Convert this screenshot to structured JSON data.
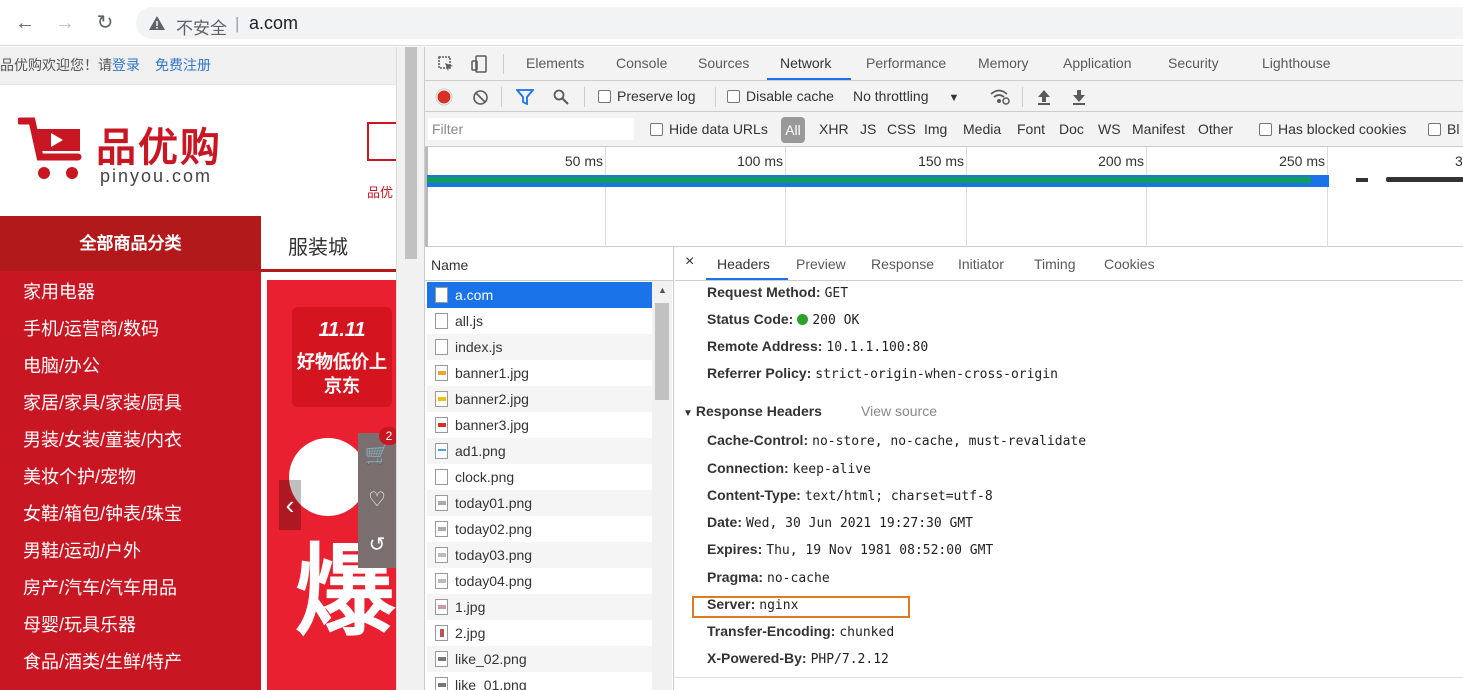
{
  "browser": {
    "insecure_label": "不安全",
    "separator": "|",
    "url": "a.com"
  },
  "site": {
    "welcome": "品优购欢迎您！请",
    "login": "登录",
    "register": "免费注册",
    "brand": "品优购",
    "domain": "pinyou.com",
    "search_hint": "品优",
    "all_categories": "全部商品分类",
    "nav_tab": "服装城",
    "categories": [
      "家用电器",
      "手机/运营商/数码",
      "电脑/办公",
      "家居/家具/家装/厨具",
      "男装/女装/童装/内衣",
      "美妆个护/宠物",
      "女鞋/箱包/钟表/珠宝",
      "男鞋/运动/户外",
      "房产/汽车/汽车用品",
      "母婴/玩具乐器",
      "食品/酒类/生鲜/特产"
    ],
    "banner_tag": "好物低价上京东",
    "banner_tag_top": "11.11",
    "banner_big": "爆",
    "cart_badge": "2"
  },
  "devtools": {
    "tabs": [
      "Elements",
      "Console",
      "Sources",
      "Network",
      "Performance",
      "Memory",
      "Application",
      "Security",
      "Lighthouse"
    ],
    "active_tab": "Network",
    "toolbar": {
      "preserve_log": "Preserve log",
      "disable_cache": "Disable cache",
      "throttling": "No throttling"
    },
    "filter": {
      "placeholder": "Filter",
      "hide_data_urls": "Hide data URLs",
      "all": "All",
      "types": [
        "XHR",
        "JS",
        "CSS",
        "Img",
        "Media",
        "Font",
        "Doc",
        "WS",
        "Manifest",
        "Other"
      ],
      "has_blocked_cookies": "Has blocked cookies",
      "blocked_truncated": "Bl"
    },
    "timeline": {
      "ticks": [
        "50 ms",
        "100 ms",
        "150 ms",
        "200 ms",
        "250 ms",
        "3"
      ]
    },
    "requests": {
      "header": "Name",
      "items": [
        "a.com",
        "all.js",
        "index.js",
        "banner1.jpg",
        "banner2.jpg",
        "banner3.jpg",
        "ad1.png",
        "clock.png",
        "today01.png",
        "today02.png",
        "today03.png",
        "today04.png",
        "1.jpg",
        "2.jpg",
        "like_02.png",
        "like_01.png"
      ],
      "selected": "a.com"
    },
    "details": {
      "close": "×",
      "tabs": [
        "Headers",
        "Preview",
        "Response",
        "Initiator",
        "Timing",
        "Cookies"
      ],
      "general": [
        {
          "key": "Request Method:",
          "value": "GET"
        },
        {
          "key": "Status Code:",
          "value": "200 OK"
        },
        {
          "key": "Remote Address:",
          "value": "10.1.1.100:80"
        },
        {
          "key": "Referrer Policy:",
          "value": "strict-origin-when-cross-origin"
        }
      ],
      "response_section": "Response Headers",
      "view_source": "View source",
      "response_headers": [
        {
          "key": "Cache-Control:",
          "value": "no-store, no-cache, must-revalidate"
        },
        {
          "key": "Connection:",
          "value": "keep-alive"
        },
        {
          "key": "Content-Type:",
          "value": "text/html; charset=utf-8"
        },
        {
          "key": "Date:",
          "value": "Wed, 30 Jun 2021 19:27:30 GMT"
        },
        {
          "key": "Expires:",
          "value": "Thu, 19 Nov 1981 08:52:00 GMT"
        },
        {
          "key": "Pragma:",
          "value": "no-cache"
        },
        {
          "key": "Server:",
          "value": "nginx"
        },
        {
          "key": "Transfer-Encoding:",
          "value": "chunked"
        },
        {
          "key": "X-Powered-By:",
          "value": "PHP/7.2.12"
        }
      ]
    }
  },
  "colors": {
    "brand_red": "#c81623",
    "accent_blue": "#1a73e8",
    "highlight_orange": "#e07a1f",
    "status_green": "#2ca02c"
  }
}
